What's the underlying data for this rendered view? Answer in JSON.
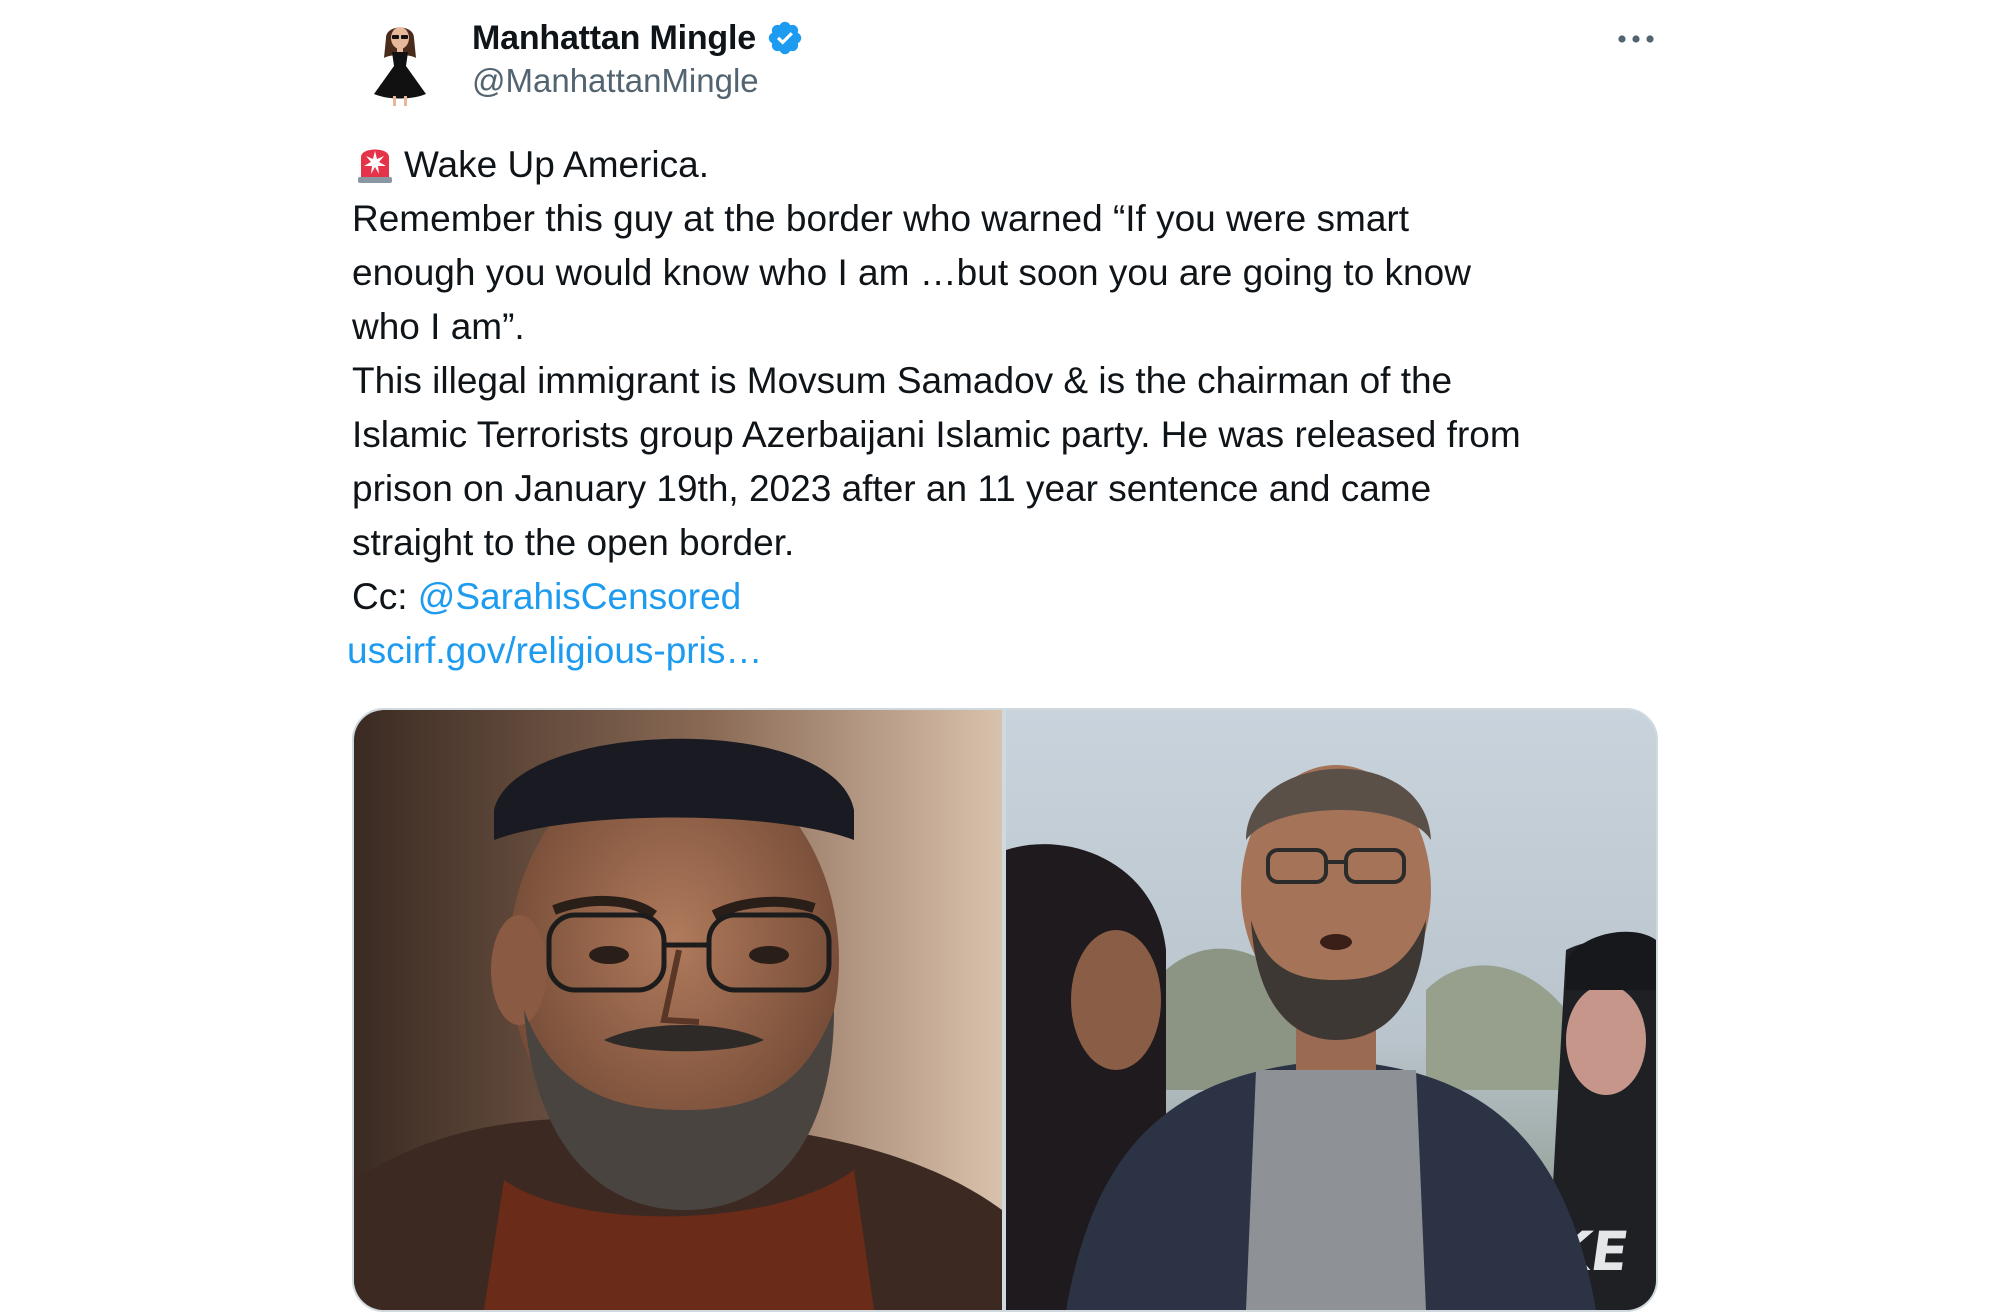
{
  "tweet": {
    "display_name": "Manhattan Mingle",
    "handle": "@ManhattanMingle",
    "verified": true,
    "avatar_icon": "avatar-illustration-woman-black-dress",
    "more_icon": "more-options-icon",
    "body_lines": [
      "Wake Up America.",
      "Remember this guy at the border who warned “If you were smart",
      "enough you would know who I am …but soon you are going to know",
      "who I am”.",
      "This illegal immigrant is Movsum Samadov & is the chairman of the",
      "Islamic Terrorists group Azerbaijani Islamic party. He was released from",
      "prison on January 19th, 2023 after an 11 year sentence and came",
      "straight to the open border."
    ],
    "cc_label": "Cc:",
    "mention": "@SarahisCensored",
    "link": "uscirf.gov/religious-pris…",
    "media": [
      {
        "icon": "photo-man-with-cap-and-glasses"
      },
      {
        "icon": "photo-man-at-border"
      }
    ]
  },
  "colors": {
    "text": "#0f1419",
    "secondary": "#536471",
    "link": "#1d9bf0",
    "verified": "#1d9bf0",
    "border": "#cfd9de"
  }
}
